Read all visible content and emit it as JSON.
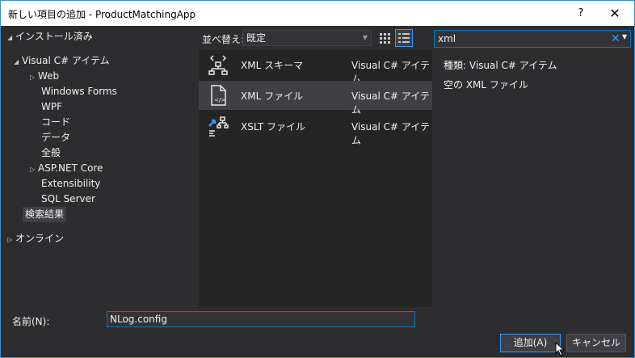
{
  "window": {
    "title": "新しい項目の追加 - ProductMatchingApp",
    "help_glyph": "?",
    "close_glyph": "✕"
  },
  "tree": {
    "installed": "インストール済み",
    "visual_cs": "Visual C# アイテム",
    "children": [
      "Web",
      "Windows Forms",
      "WPF",
      "コード",
      "データ",
      "全般",
      "ASP.NET Core",
      "Extensibility",
      "SQL Server"
    ],
    "search_results": "検索結果",
    "online": "オンライン"
  },
  "toolbar": {
    "sort_label": "並べ替え:",
    "sort_value": "既定"
  },
  "search": {
    "value": "xml",
    "clear_glyph": "✕"
  },
  "templates": [
    {
      "name": "XML スキーマ",
      "type": "Visual C# アイテム",
      "icon": "xml-schema-icon"
    },
    {
      "name": "XML ファイル",
      "type": "Visual C# アイテム",
      "icon": "xml-file-icon"
    },
    {
      "name": "XSLT ファイル",
      "type": "Visual C# アイテム",
      "icon": "xslt-file-icon"
    }
  ],
  "selected_index": 1,
  "detail": {
    "type_label": "種類:",
    "type_value": "Visual C# アイテム",
    "description": "空の XML ファイル"
  },
  "footer": {
    "name_label": "名前(N):",
    "name_value": "NLog.config",
    "add_label": "追加(A)",
    "cancel_label": "キャンセル"
  }
}
